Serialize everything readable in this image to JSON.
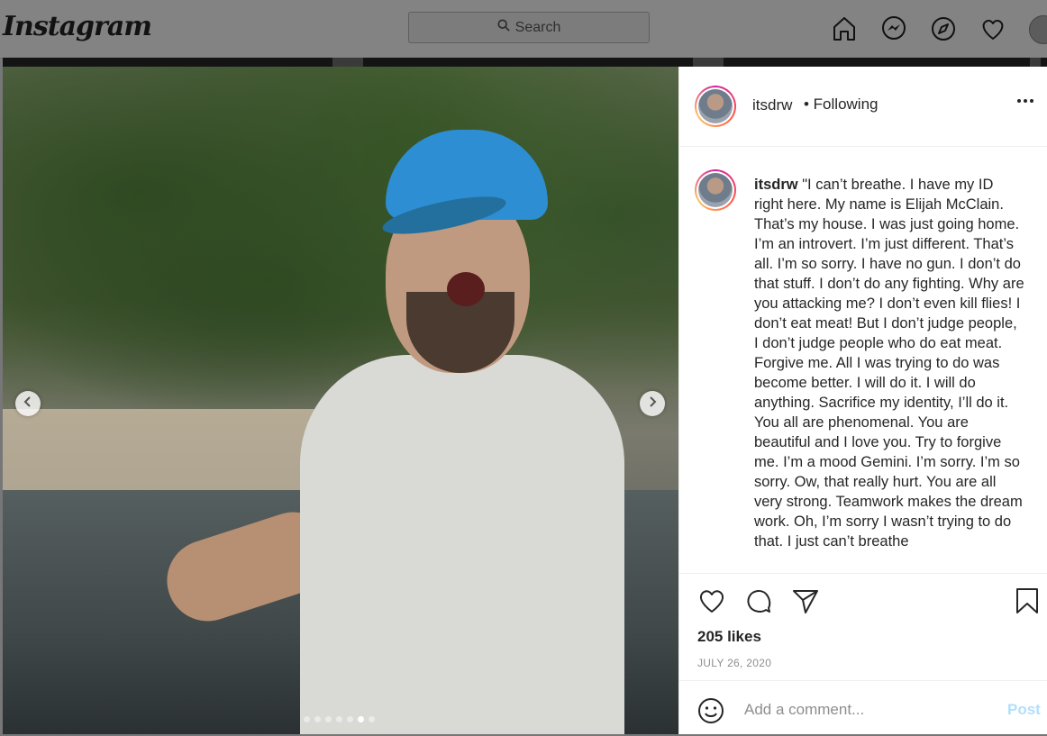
{
  "topbar": {
    "logo": "Instagram",
    "search_placeholder": "Search",
    "icons": [
      "home-icon",
      "messenger-icon",
      "explore-icon",
      "activity-heart-icon",
      "profile-avatar"
    ]
  },
  "post": {
    "username": "itsdrw",
    "follow_status": "• Following",
    "carousel": {
      "total_slides": 7,
      "active_slide": 6
    },
    "caption": "\"I can’t breathe. I have my ID right here. My name is Elijah McClain. That’s my house. I was just going home. I’m an introvert. I’m just different. That’s all. I’m so sorry. I have no gun. I don’t do that stuff. I don’t do any fighting. Why are you attacking me? I don’t even kill flies! I don’t eat meat! But I don’t judge people, I don’t judge people who do eat meat. Forgive me. All I was trying to do was become better. I will do it. I will do anything. Sacrifice my identity, I’ll do it. You all are phenomenal. You are beautiful and I love you. Try to forgive me. I’m a mood Gemini. I’m sorry. I’m so sorry. Ow, that really hurt. You are all very strong. Teamwork makes the dream work. Oh, I’m sorry I wasn’t trying to do that. I just can’t breathe",
    "likes": "205 likes",
    "date": "JULY 26, 2020",
    "comment_placeholder": "Add a comment...",
    "post_label": "Post"
  },
  "colors": {
    "post_button": "#b2dffc",
    "text": "#262626",
    "muted": "#8e8e8e"
  }
}
